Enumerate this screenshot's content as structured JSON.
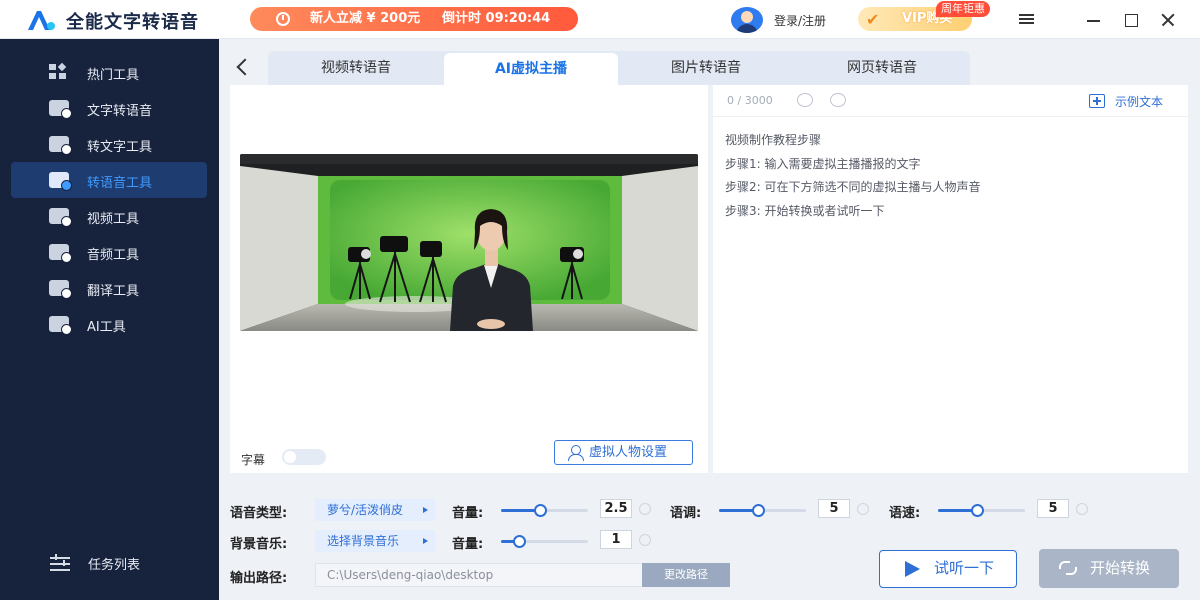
{
  "app": {
    "title": "全能文字转语音",
    "brand_color": "#1a73e8"
  },
  "promo": {
    "label": "新人立减 ¥ 200元",
    "countdown_label": "倒计时 09:20:44",
    "icon": "alarm-clock-icon"
  },
  "user": {
    "login_label": "登录/注册",
    "vip_label": "VIP购买",
    "vip_badge": "周年钜惠"
  },
  "sidebar": {
    "items": [
      {
        "label": "热门工具",
        "icon": "grid-icon"
      },
      {
        "label": "文字转语音",
        "icon": "text-to-speech-icon"
      },
      {
        "label": "转文字工具",
        "icon": "to-text-icon"
      },
      {
        "label": "转语音工具",
        "icon": "to-speech-icon",
        "active": true
      },
      {
        "label": "视频工具",
        "icon": "video-icon"
      },
      {
        "label": "音频工具",
        "icon": "audio-icon"
      },
      {
        "label": "翻译工具",
        "icon": "translate-icon"
      },
      {
        "label": "AI工具",
        "icon": "ai-icon"
      }
    ],
    "tasks_label": "任务列表"
  },
  "tabs": [
    {
      "label": "视频转语音"
    },
    {
      "label": "AI虚拟主播",
      "active": true
    },
    {
      "label": "图片转语音"
    },
    {
      "label": "网页转语音"
    }
  ],
  "preview": {
    "subtitle_label": "字幕",
    "subtitle_on": false,
    "avatar_settings_label": "虚拟人物设置"
  },
  "editor": {
    "counter": "0 / 3000",
    "sample_label": "示例文本",
    "steps": [
      "视频制作教程步骤",
      "步骤1:  输入需要虚拟主播播报的文字",
      "步骤2:  可在下方筛选不同的虚拟主播与人物声音",
      "步骤3:  开始转换或者试听一下"
    ]
  },
  "settings": {
    "voice_type_label": "语音类型:",
    "voice_type_value": "萝兮/活泼俏皮",
    "volume_label": "音量:",
    "volume_value": "2.5",
    "pitch_label": "语调:",
    "pitch_value": "5",
    "speed_label": "语速:",
    "speed_value": "5",
    "bgm_label": "背景音乐:",
    "bgm_value": "选择背景音乐",
    "bgm_volume_label": "音量:",
    "bgm_volume_value": "1",
    "output_label": "输出路径:",
    "output_path": "C:\\Users\\deng-qiao\\desktop",
    "change_path_label": "更改路径"
  },
  "actions": {
    "try_label": "试听一下",
    "start_label": "开始转换"
  }
}
